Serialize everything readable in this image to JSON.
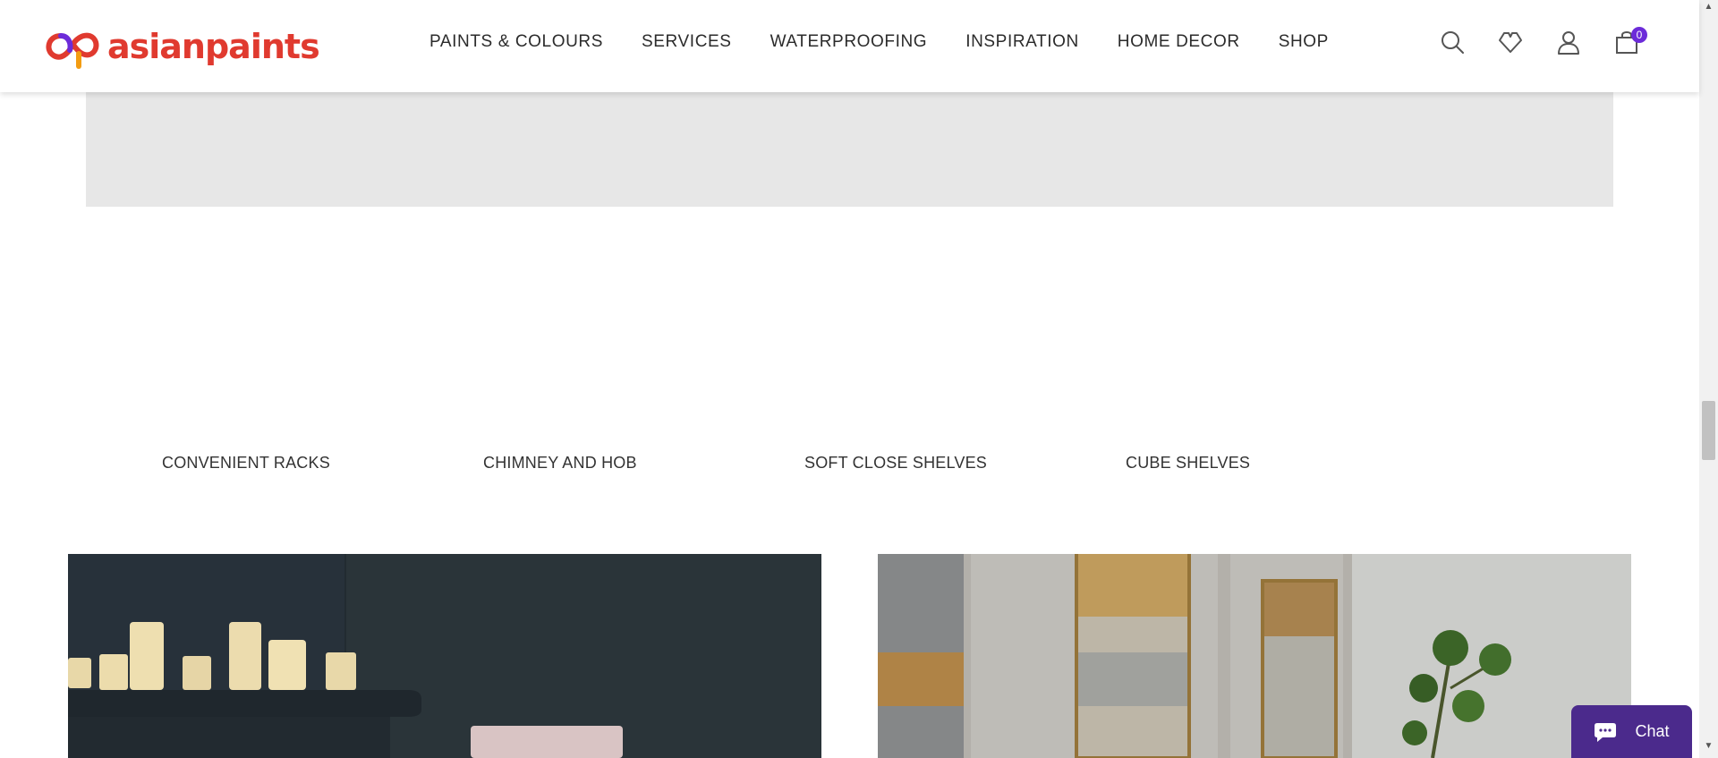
{
  "brand": {
    "name": "asianpaints"
  },
  "nav": {
    "items": [
      "PAINTS & COLOURS",
      "SERVICES",
      "WATERPROOFING",
      "INSPIRATION",
      "HOME DECOR",
      "SHOP"
    ]
  },
  "header_icons": {
    "search": "search-icon",
    "wishlist": "heart-icon",
    "account": "user-icon",
    "cart": "shopping-bag-icon",
    "cart_count": "0"
  },
  "categories": [
    "CONVENIENT RACKS",
    "CHIMNEY AND HOB",
    "SOFT CLOSE SHELVES",
    "CUBE SHELVES"
  ],
  "chat": {
    "label": "Chat"
  },
  "colors": {
    "brand_red": "#e03a2f",
    "brand_purple": "#6c2bd9",
    "chat_bg": "#4b2a8c",
    "panel_gray": "#e7e7e7"
  }
}
